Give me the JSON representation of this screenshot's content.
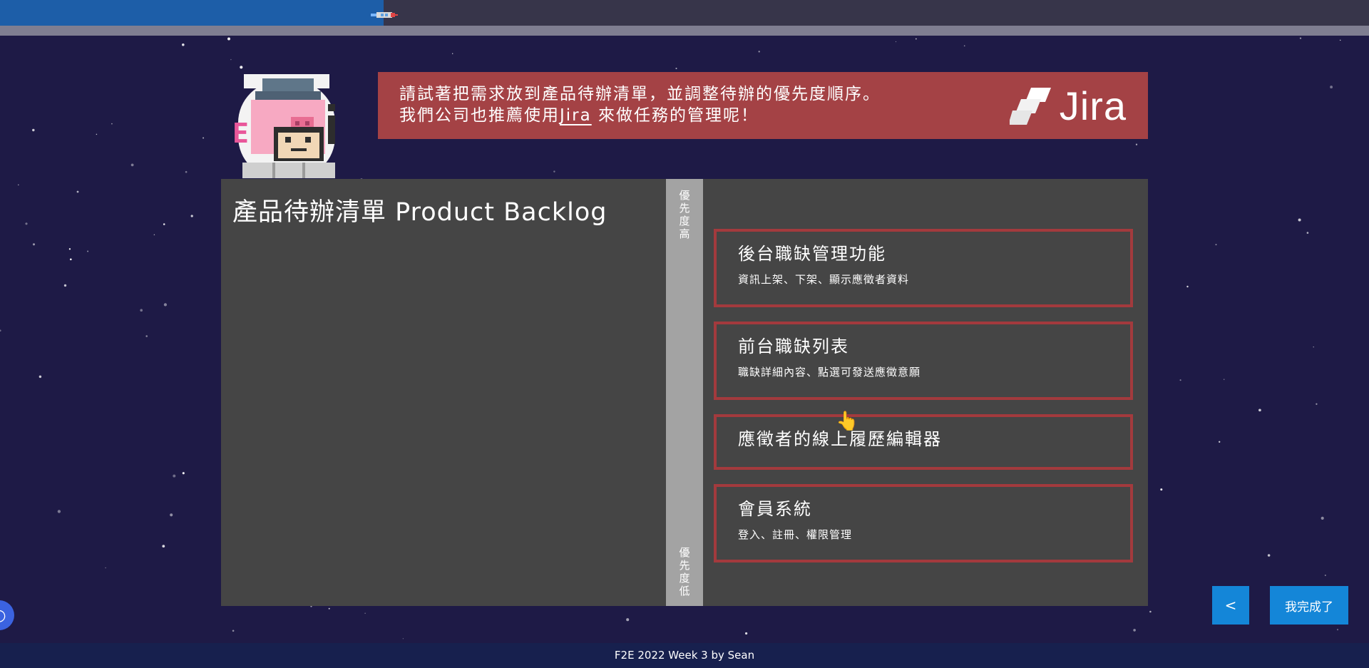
{
  "header": {
    "progress_percent": 28
  },
  "banner": {
    "line1": "請試著把需求放到產品待辦清單，並調整待辦的優先度順序。",
    "line2_prefix": "我們公司也推薦使用",
    "line2_link": "Jira",
    "line2_suffix": " 來做任務的管理呢！",
    "logo_text": "Jira"
  },
  "avatar": {
    "badge_letter": "E"
  },
  "backlog": {
    "title": "產品待辦清單 Product Backlog"
  },
  "priority": {
    "high": [
      "優",
      "先",
      "度",
      "高"
    ],
    "low": [
      "優",
      "先",
      "度",
      "低"
    ]
  },
  "cards": [
    {
      "title": "後台職缺管理功能",
      "desc": "資訊上架、下架、顯示應徵者資料"
    },
    {
      "title": "前台職缺列表",
      "desc": "職缺詳細內容、點選可發送應徵意願"
    },
    {
      "title": "應徵者的線上履歷編輯器",
      "desc": ""
    },
    {
      "title": "會員系統",
      "desc": "登入、註冊、權限管理"
    }
  ],
  "buttons": {
    "prev_label": "<",
    "done_label": "我完成了"
  },
  "footer": {
    "credit": "F2E 2022 Week 3 by Sean"
  },
  "colors": {
    "background": "#1e1a46",
    "banner": "#a44245",
    "board": "#454545",
    "card_border": "#a33a3d",
    "button": "#1486d8",
    "footer": "#17204e"
  }
}
